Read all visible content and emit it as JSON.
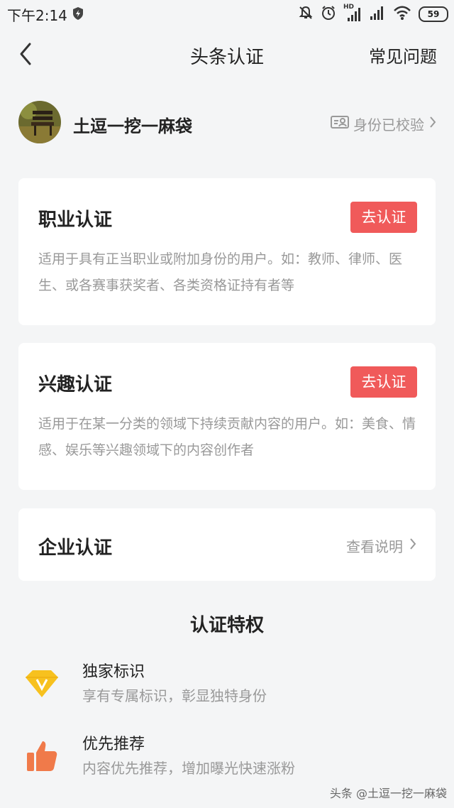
{
  "status_bar": {
    "time": "下午2:14",
    "hd_label": "HD",
    "battery": "59",
    "icons": [
      "shield-icon",
      "mute-bell-icon",
      "alarm-icon",
      "signal-icon",
      "signal-icon",
      "wifi-icon",
      "battery-icon"
    ]
  },
  "nav": {
    "title": "头条认证",
    "faq": "常见问题",
    "back_icon": "chevron-left-icon"
  },
  "profile": {
    "username": "土逗一挖一麻袋",
    "verified_label": "身份已校验"
  },
  "cards": {
    "professional": {
      "title": "职业认证",
      "button": "去认证",
      "desc": "适用于具有正当职业或附加身份的用户。如：教师、律师、医生、或各赛事获奖者、各类资格证持有者等"
    },
    "interest": {
      "title": "兴趣认证",
      "button": "去认证",
      "desc": "适用于在某一分类的领域下持续贡献内容的用户。如：美食、情感、娱乐等兴趣领域下的内容创作者"
    },
    "enterprise": {
      "title": "企业认证",
      "link": "查看说明"
    }
  },
  "privileges": {
    "title": "认证特权",
    "items": [
      {
        "title": "独家标识",
        "desc": "享有专属标识，彰显独特身份",
        "icon": "diamond-v-icon"
      },
      {
        "title": "优先推荐",
        "desc": "内容优先推荐，增加曝光快速涨粉",
        "icon": "thumbs-up-icon"
      }
    ]
  },
  "watermark": "头条 @土逗一挖一麻袋",
  "colors": {
    "accent": "#f05a5a",
    "background": "#f4f5f6",
    "muted_text": "#999999"
  }
}
